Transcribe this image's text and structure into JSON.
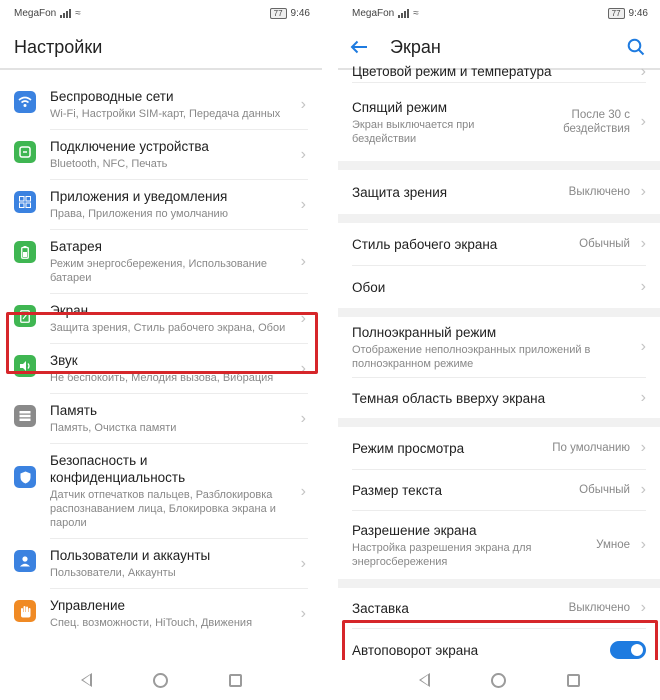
{
  "status": {
    "carrier": "MegaFon",
    "battery": "77",
    "time": "9:46"
  },
  "left": {
    "title": "Настройки",
    "items": [
      {
        "title": "Беспроводные сети",
        "subtitle": "Wi-Fi, Настройки SIM-карт, Передача данных",
        "icon": "wifi-icon",
        "color": "#3b82e0"
      },
      {
        "title": "Подключение устройства",
        "subtitle": "Bluetooth, NFC, Печать",
        "icon": "device-connection-icon",
        "color": "#3fb652"
      },
      {
        "title": "Приложения и уведомления",
        "subtitle": "Права, Приложения по умолчанию",
        "icon": "apps-icon",
        "color": "#3b82e0"
      },
      {
        "title": "Батарея",
        "subtitle": "Режим энергосбережения, Использование батареи",
        "icon": "battery-icon",
        "color": "#3fb652"
      },
      {
        "title": "Экран",
        "subtitle": "Защита зрения, Стиль рабочего экрана, Обои",
        "icon": "display-icon",
        "color": "#3fb652"
      },
      {
        "title": "Звук",
        "subtitle": "Не беспокоить, Мелодия вызова, Вибрация",
        "icon": "sound-icon",
        "color": "#3fb652"
      },
      {
        "title": "Память",
        "subtitle": "Память, Очистка памяти",
        "icon": "storage-icon",
        "color": "#8a8a8a"
      },
      {
        "title": "Безопасность и конфиденциальность",
        "subtitle": "Датчик отпечатков пальцев, Разблокировка распознаванием лица, Блокировка экрана и пароли",
        "icon": "security-shield-icon",
        "color": "#3b82e0"
      },
      {
        "title": "Пользователи и аккаунты",
        "subtitle": "Пользователи, Аккаунты",
        "icon": "user-icon",
        "color": "#3b82e0"
      },
      {
        "title": "Управление",
        "subtitle": "Спец. возможности, HiTouch, Движения",
        "icon": "hand-icon",
        "color": "#f08a24"
      }
    ]
  },
  "right": {
    "title": "Экран",
    "partial": "Цветовой режим и температура",
    "items": [
      {
        "title": "Спящий режим",
        "subtitle": "Экран выключается при бездействии",
        "value": "После 30 с бездействия"
      },
      {
        "title": "Защита зрения",
        "value": "Выключено"
      },
      {
        "title": "Стиль рабочего экрана",
        "value": "Обычный"
      },
      {
        "title": "Обои",
        "value": ""
      },
      {
        "title": "Полноэкранный режим",
        "subtitle": "Отображение неполноэкранных приложений в полноэкранном режиме",
        "value": ""
      },
      {
        "title": "Темная область вверху экрана",
        "value": ""
      },
      {
        "title": "Режим просмотра",
        "value": "По умолчанию"
      },
      {
        "title": "Размер текста",
        "value": "Обычный"
      },
      {
        "title": "Разрешение экрана",
        "subtitle": "Настройка разрешения экрана для энергосбережения",
        "value": "Умное"
      },
      {
        "title": "Заставка",
        "value": "Выключено"
      },
      {
        "title": "Автоповорот экрана",
        "toggle_on": true
      }
    ]
  },
  "colors": {
    "accent": "#1e7be0",
    "highlight": "#d6262a"
  }
}
